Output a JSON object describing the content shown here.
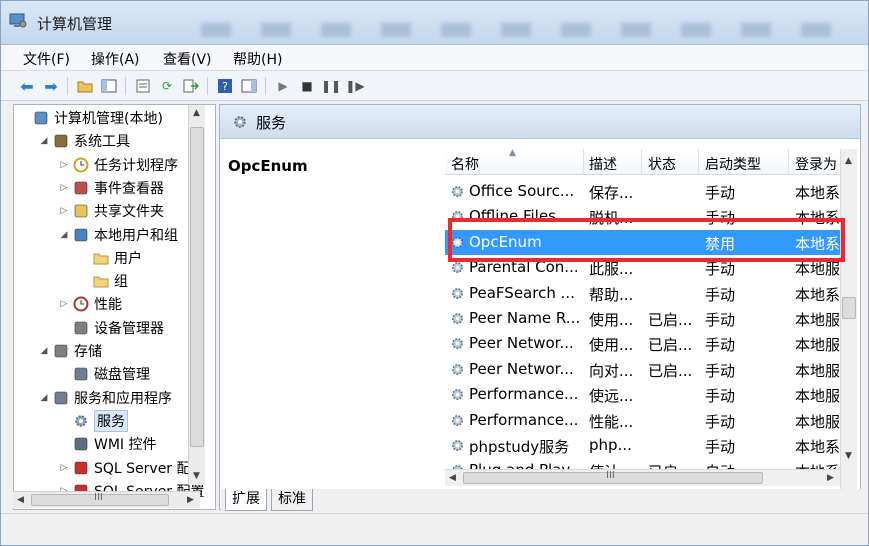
{
  "window": {
    "title": "计算机管理"
  },
  "menu": [
    "文件(F)",
    "操作(A)",
    "查看(V)",
    "帮助(H)"
  ],
  "tree": [
    {
      "label": "计算机管理(本地)",
      "level": 0,
      "expander": "",
      "icon": "computer-icon"
    },
    {
      "label": "系统工具",
      "level": 1,
      "expander": "◢",
      "icon": "tools-icon"
    },
    {
      "label": "任务计划程序",
      "level": 2,
      "expander": "▷",
      "icon": "clock-icon"
    },
    {
      "label": "事件查看器",
      "level": 2,
      "expander": "▷",
      "icon": "event-viewer-icon"
    },
    {
      "label": "共享文件夹",
      "level": 2,
      "expander": "▷",
      "icon": "shared-folder-icon"
    },
    {
      "label": "本地用户和组",
      "level": 2,
      "expander": "◢",
      "icon": "users-icon"
    },
    {
      "label": "用户",
      "level": 3,
      "expander": "",
      "icon": "folder-icon"
    },
    {
      "label": "组",
      "level": 3,
      "expander": "",
      "icon": "folder-icon"
    },
    {
      "label": "性能",
      "level": 2,
      "expander": "▷",
      "icon": "performance-icon"
    },
    {
      "label": "设备管理器",
      "level": 2,
      "expander": "",
      "icon": "device-manager-icon"
    },
    {
      "label": "存储",
      "level": 1,
      "expander": "◢",
      "icon": "storage-icon"
    },
    {
      "label": "磁盘管理",
      "level": 2,
      "expander": "",
      "icon": "disk-icon"
    },
    {
      "label": "服务和应用程序",
      "level": 1,
      "expander": "◢",
      "icon": "services-apps-icon"
    },
    {
      "label": "服务",
      "level": 2,
      "expander": "",
      "icon": "gear-icon",
      "selected": true
    },
    {
      "label": "WMI 控件",
      "level": 2,
      "expander": "",
      "icon": "wmi-icon"
    },
    {
      "label": "SQL Server 配置",
      "level": 2,
      "expander": "▷",
      "icon": "sql-icon"
    },
    {
      "label": "SQL Server 配置",
      "level": 2,
      "expander": "▷",
      "icon": "sql-icon"
    }
  ],
  "right": {
    "header": "服务",
    "detail_title": "OpcEnum",
    "columns": [
      "名称",
      "描述",
      "状态",
      "启动类型",
      "登录为"
    ],
    "rows": [
      {
        "name": "Office Sourc...",
        "desc": "保存...",
        "status": "",
        "startup": "手动",
        "logon": "本地系"
      },
      {
        "name": "Offline Files",
        "desc": "脱机...",
        "status": "",
        "startup": "手动",
        "logon": "本地系"
      },
      {
        "name": "OpcEnum",
        "desc": "",
        "status": "",
        "startup": "禁用",
        "logon": "本地系",
        "selected": true
      },
      {
        "name": "Parental Con...",
        "desc": "此服...",
        "status": "",
        "startup": "手动",
        "logon": "本地服"
      },
      {
        "name": "PeaFSearch ...",
        "desc": "帮助...",
        "status": "",
        "startup": "手动",
        "logon": "本地系"
      },
      {
        "name": "Peer Name R...",
        "desc": "使用...",
        "status": "已启...",
        "startup": "手动",
        "logon": "本地服"
      },
      {
        "name": "Peer Networ...",
        "desc": "使用...",
        "status": "已启...",
        "startup": "手动",
        "logon": "本地服"
      },
      {
        "name": "Peer Networ...",
        "desc": "向对...",
        "status": "已启...",
        "startup": "手动",
        "logon": "本地服"
      },
      {
        "name": "Performance...",
        "desc": "使远...",
        "status": "",
        "startup": "手动",
        "logon": "本地服"
      },
      {
        "name": "Performance...",
        "desc": "性能...",
        "status": "",
        "startup": "手动",
        "logon": "本地服"
      },
      {
        "name": "phpstudy服务",
        "desc": "php...",
        "status": "",
        "startup": "手动",
        "logon": "本地系"
      },
      {
        "name": "Plug and Play",
        "desc": "使计...",
        "status": "已启...",
        "startup": "自动",
        "logon": "本地系"
      }
    ]
  },
  "tabs": [
    "扩展",
    "标准"
  ],
  "scroll": {
    "h_grip": "III"
  },
  "colors": {
    "selection": "#3399ff",
    "highlight": "#f0282d"
  }
}
